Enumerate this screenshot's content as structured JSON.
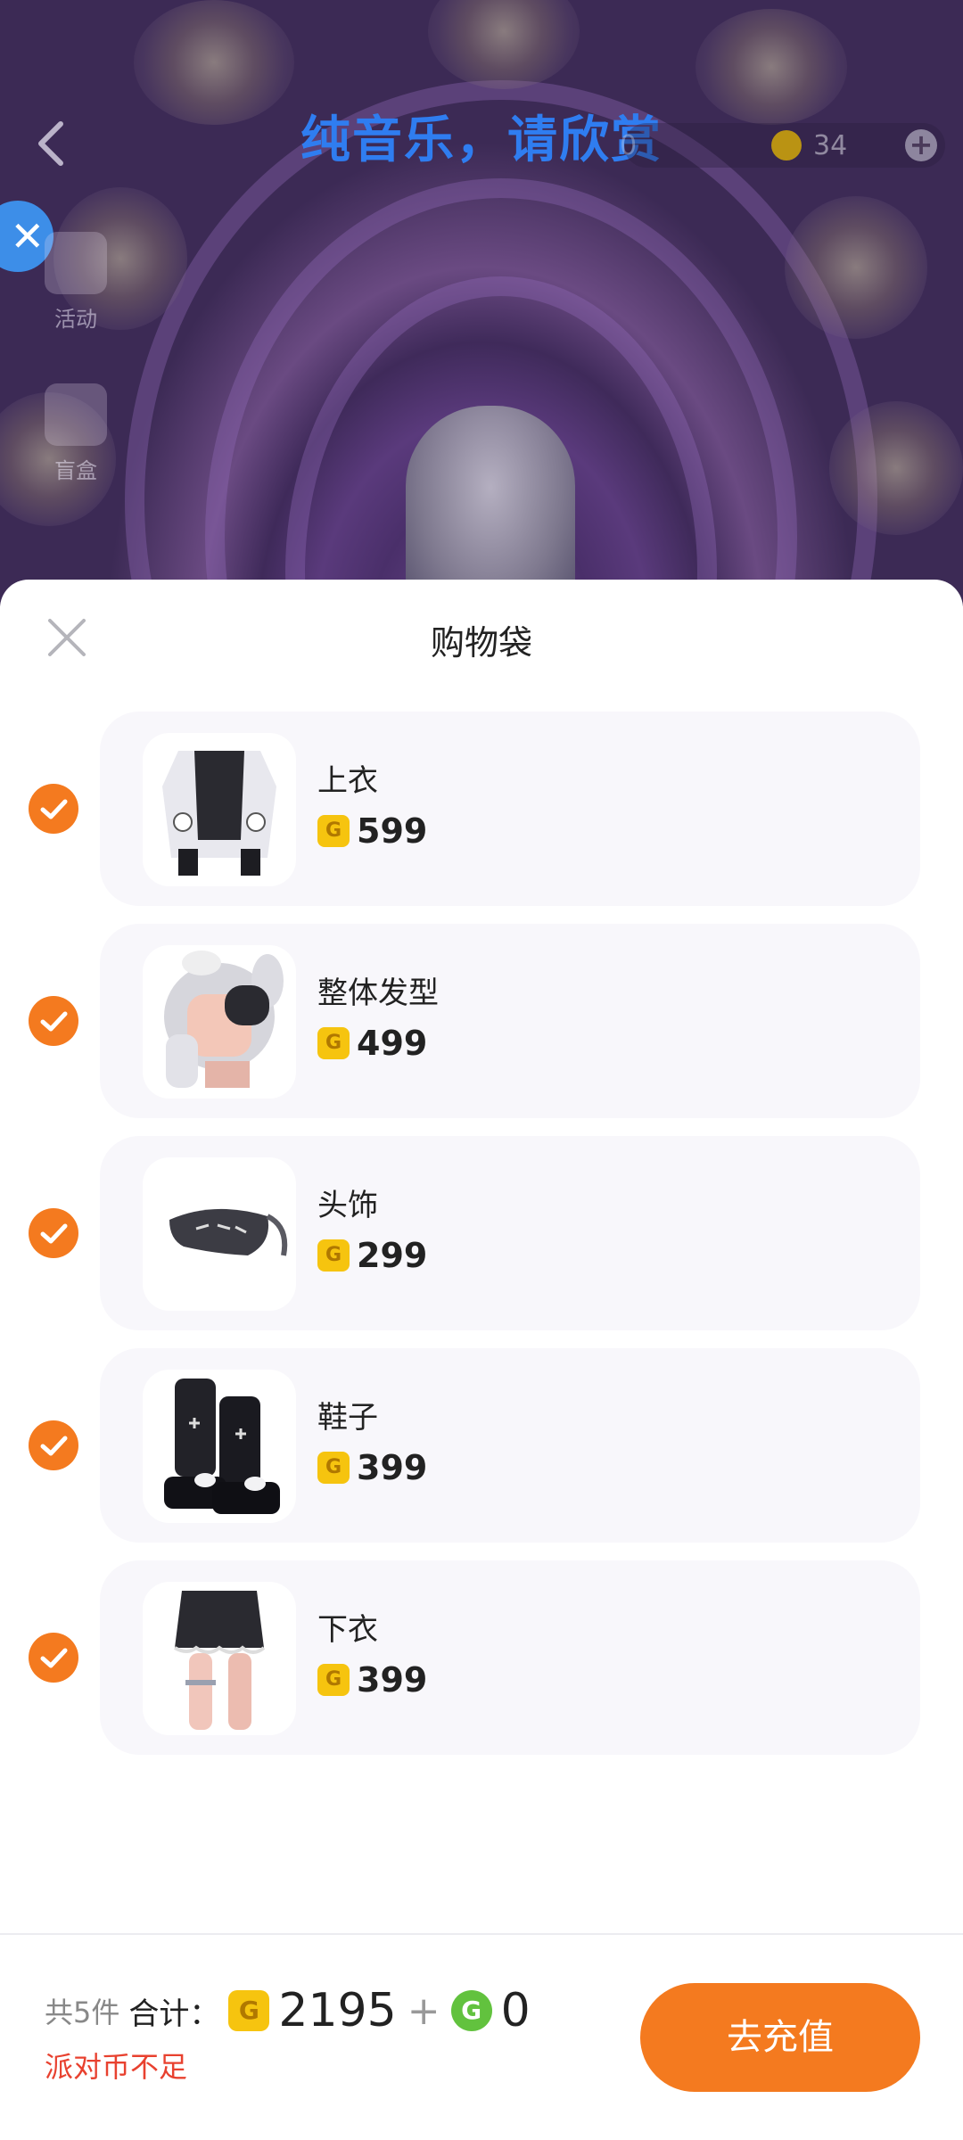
{
  "header": {
    "title": "纯音乐，请欣赏",
    "currency_count": "34",
    "faded_count": "0"
  },
  "side_menu": {
    "items": [
      {
        "label": "活动"
      },
      {
        "label": "盲盒"
      }
    ]
  },
  "sheet": {
    "title": "购物袋",
    "items": [
      {
        "name": "上衣",
        "price": "599",
        "checked": true,
        "icon": "top-clothing-icon"
      },
      {
        "name": "整体发型",
        "price": "499",
        "checked": true,
        "icon": "hairstyle-icon"
      },
      {
        "name": "头饰",
        "price": "299",
        "checked": true,
        "icon": "headwear-icon"
      },
      {
        "name": "鞋子",
        "price": "399",
        "checked": true,
        "icon": "shoes-icon"
      },
      {
        "name": "下衣",
        "price": "399",
        "checked": true,
        "icon": "bottoms-icon"
      }
    ]
  },
  "footer": {
    "count_label": "共5件",
    "total_label": "合计：",
    "gold_total": "2195",
    "plus": "+",
    "green_total": "0",
    "warning": "派对币不足",
    "recharge_label": "去充值"
  },
  "colors": {
    "accent": "#f47a1f",
    "title_blue": "#2f7df0",
    "warning_red": "#e8412f",
    "gold": "#f6c40f",
    "green_coin": "#62c23e"
  }
}
